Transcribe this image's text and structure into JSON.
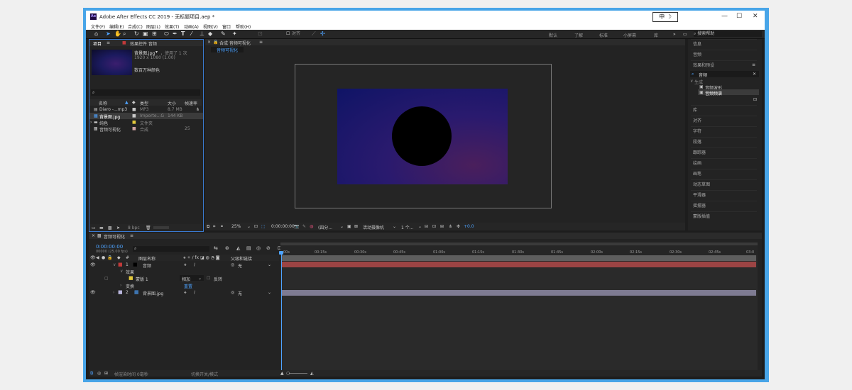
{
  "window": {
    "title": "Adobe After Effects CC 2019 - 无标题项目.aep *",
    "logo_text": "Ae",
    "ime_indicator": "中"
  },
  "menu": [
    "文件(F)",
    "编辑(E)",
    "合成(C)",
    "图层(L)",
    "效果(T)",
    "动画(A)",
    "视图(V)",
    "窗口",
    "帮助(H)"
  ],
  "toolbar": {
    "align_label": "对齐",
    "workspaces": [
      "默认",
      "了解",
      "标准",
      "小屏幕",
      "库"
    ],
    "search_help": "搜索帮助"
  },
  "project": {
    "tab_project": "项目",
    "tab_effects": "效果控件 音频",
    "preview_name": "背景图.jpg",
    "preview_usage": "，使用了 1 次",
    "preview_size": "1920 x 1080 (1.00)",
    "preview_note": "数百万种颜色",
    "columns": [
      "名称",
      "类型",
      "大小",
      "帧速率"
    ],
    "rows": [
      {
        "name": "Diaro -...mp3",
        "type": "MP3",
        "size": "8.7 MB",
        "color": "#c9c9c9"
      },
      {
        "name": "背景图.jpg",
        "type": "Importe...G",
        "size": "144 KB",
        "color": "#c9c9c9"
      },
      {
        "name": "纯色",
        "type": "文件夹",
        "size": "",
        "color": "#e3c93c"
      },
      {
        "name": "音频可视化",
        "type": "合成",
        "size": "25",
        "color": "#d1a4a4"
      }
    ],
    "bpc": "8 bpc"
  },
  "composition": {
    "tab_label": "合成 音频可视化",
    "sub_tab": "音频可视化",
    "zoom": "25%",
    "timecode": "0:00:00:00",
    "resolution": "(四分...",
    "camera": "活动摄像机",
    "views": "1 个...",
    "exposure": "+0.0"
  },
  "right_panel": {
    "items_top": [
      "信息",
      "音频",
      "效果和预设"
    ],
    "search_value": "音频",
    "tree_root": "生成",
    "tree_items": [
      "音频波形",
      "音频频谱"
    ],
    "items_bottom": [
      "库",
      "对齐",
      "字符",
      "段落",
      "跟踪器",
      "绘画",
      "画笔",
      "动态草图",
      "平滑器",
      "摇摆器",
      "蒙版插值"
    ]
  },
  "timeline": {
    "tab_label": "音频可视化",
    "timecode": "0:00:00:00",
    "fps_note": "00000 (25.00 fps)",
    "col_source": "图层名称",
    "col_parent": "父级和链接",
    "ticks": [
      "00s",
      "00:15s",
      "00:30s",
      "00:45s",
      "01:00s",
      "01:15s",
      "01:30s",
      "01:45s",
      "02:00s",
      "02:15s",
      "02:30s",
      "02:45s",
      "03:0"
    ],
    "layers": [
      {
        "num": "1",
        "name": "音频",
        "label_color": "#c23a3a",
        "parent": "无",
        "bar_color": "#9c4444"
      },
      {
        "num": "2",
        "name": "背景图.jpg",
        "label_color": "#b9b6dc",
        "parent": "无",
        "bar_color": "#7e7b92"
      }
    ],
    "sub_effects": "效果",
    "sub_mask": "蒙版 1",
    "sub_mode": "相加",
    "sub_invert": "反转",
    "sub_transform": "变换",
    "sub_reset": "重置",
    "footer_toggle": "切换开关/模式",
    "footer_render": "帧渲染时间 0毫秒"
  },
  "colors": {
    "accent": "#4ea3ff",
    "frame": "#48a5e8",
    "background": "#1d1d1d"
  }
}
